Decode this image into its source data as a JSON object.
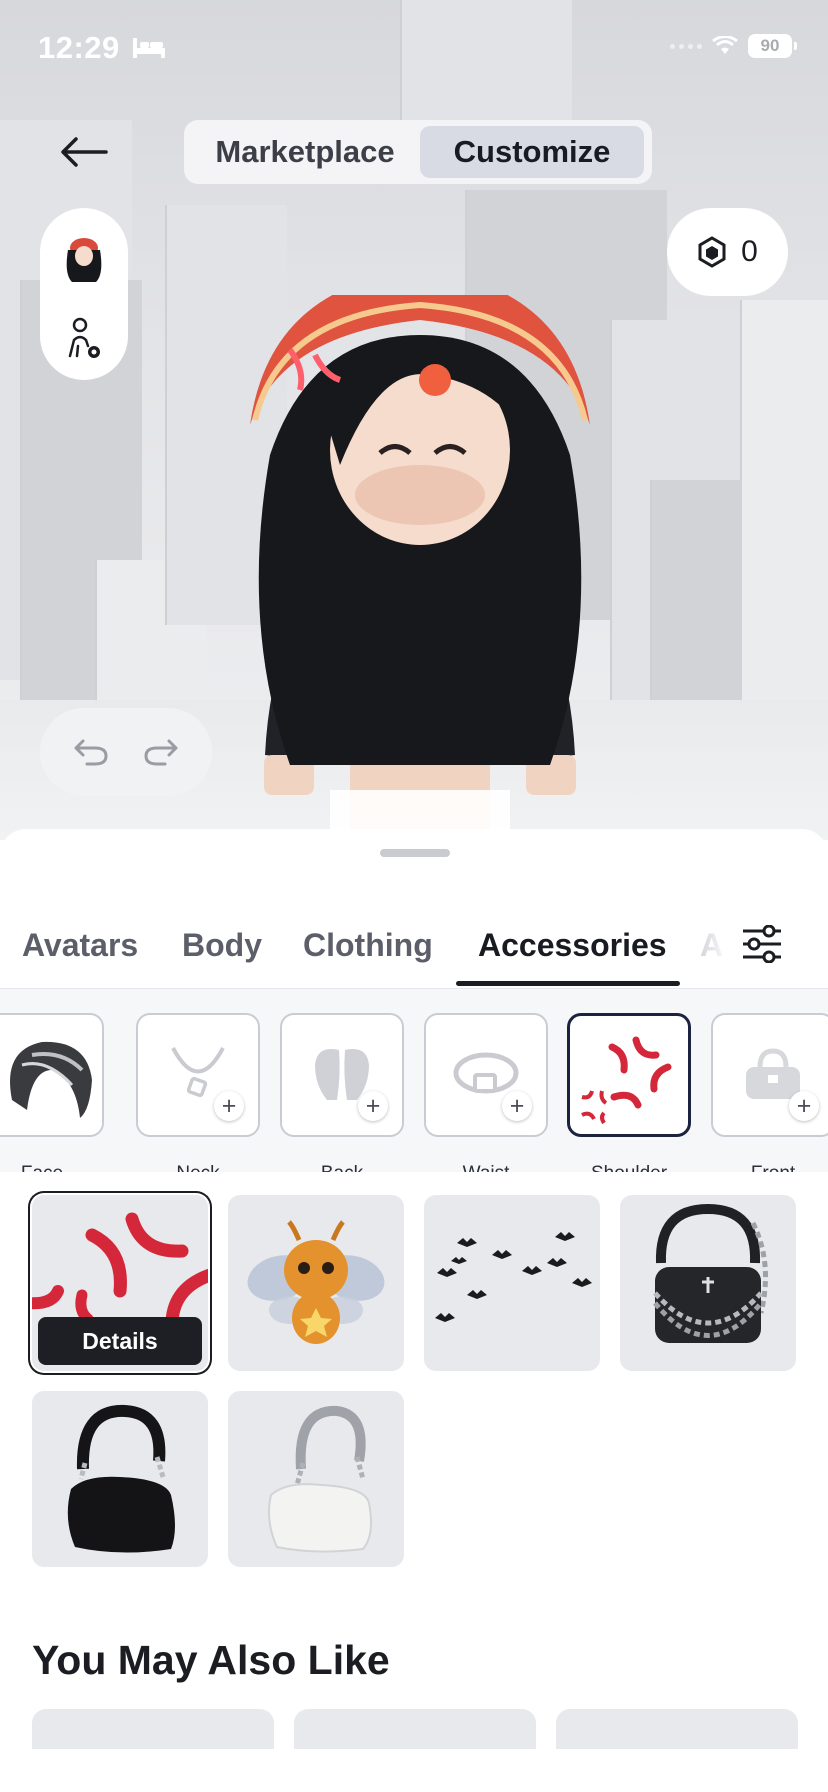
{
  "status_bar": {
    "time": "12:29",
    "battery": "90"
  },
  "header": {
    "segments": [
      {
        "label": "Marketplace",
        "active": false
      },
      {
        "label": "Customize",
        "active": true
      }
    ]
  },
  "robux": {
    "balance": "0"
  },
  "tabs": [
    {
      "label": "Avatars",
      "active": false
    },
    {
      "label": "Body",
      "active": false
    },
    {
      "label": "Clothing",
      "active": false
    },
    {
      "label": "Accessories",
      "active": true
    },
    {
      "label": "A",
      "active": false
    }
  ],
  "categories": [
    {
      "label": "Face",
      "icon": "hair-icon",
      "selected": false
    },
    {
      "label": "Neck",
      "icon": "necklace-icon",
      "selected": false
    },
    {
      "label": "Back",
      "icon": "wings-icon",
      "selected": false
    },
    {
      "label": "Waist",
      "icon": "belt-icon",
      "selected": false
    },
    {
      "label": "Shoulder",
      "icon": "anger-mark-icon",
      "selected": true
    },
    {
      "label": "Front",
      "icon": "bag-icon",
      "selected": false
    }
  ],
  "items": [
    {
      "name": "anger-mark-item",
      "selected": true,
      "action": "Details"
    },
    {
      "name": "bee-fairy-item",
      "selected": false
    },
    {
      "name": "bats-item",
      "selected": false
    },
    {
      "name": "chain-purse-item",
      "selected": false
    },
    {
      "name": "black-shoulder-bag-item",
      "selected": false
    },
    {
      "name": "white-shoulder-bag-item",
      "selected": false
    }
  ],
  "recommendations": {
    "title": "You May Also Like"
  },
  "colors": {
    "accent_dark": "#1b1d22",
    "selected_border": "#1c2340",
    "anger_red": "#d5273a"
  }
}
